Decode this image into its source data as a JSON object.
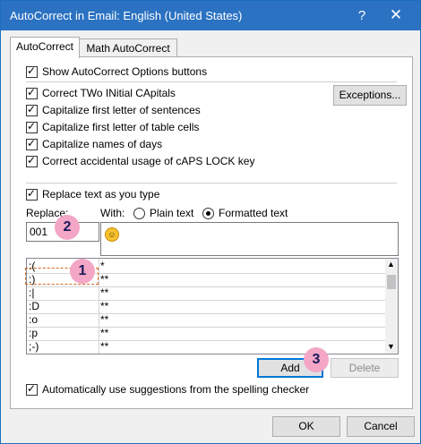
{
  "window": {
    "title": "AutoCorrect in Email: English (United States)",
    "help_label": "?",
    "close_label": "✕"
  },
  "tabs": [
    {
      "label": "AutoCorrect",
      "active": true
    },
    {
      "label": "Math AutoCorrect",
      "active": false
    }
  ],
  "options": {
    "show_buttons": "Show AutoCorrect Options buttons",
    "two_initial": "Correct TWo INitial CApitals",
    "first_letter_sentences": "Capitalize first letter of sentences",
    "first_letter_cells": "Capitalize first letter of table cells",
    "names_days": "Capitalize names of days",
    "caps_lock": "Correct accidental usage of cAPS LOCK key",
    "exceptions_label": "Exceptions...",
    "replace_as_type": "Replace text as you type"
  },
  "replace": {
    "replace_label": "Replace:",
    "with_label": "With:",
    "plain_text": "Plain text",
    "formatted_text": "Formatted text",
    "replace_value": "001",
    "with_value": "☺"
  },
  "list": {
    "rows": [
      {
        "replace": ":(",
        "with": "*"
      },
      {
        "replace": ":)",
        "with": "**"
      },
      {
        "replace": ":|",
        "with": "**"
      },
      {
        "replace": ":D",
        "with": "**"
      },
      {
        "replace": ":o",
        "with": "**"
      },
      {
        "replace": ":p",
        "with": "**"
      },
      {
        "replace": ";-)",
        "with": "**"
      }
    ]
  },
  "actions": {
    "add_label": "Add",
    "delete_label": "Delete",
    "auto_suggestions": "Automatically use suggestions from the spelling checker",
    "ok_label": "OK",
    "cancel_label": "Cancel"
  },
  "callouts": [
    "1",
    "2",
    "3"
  ],
  "colors": {
    "titlebar": "#2b72c2",
    "badge": "#f4a6c6",
    "dashed_outline": "#d2691e"
  }
}
